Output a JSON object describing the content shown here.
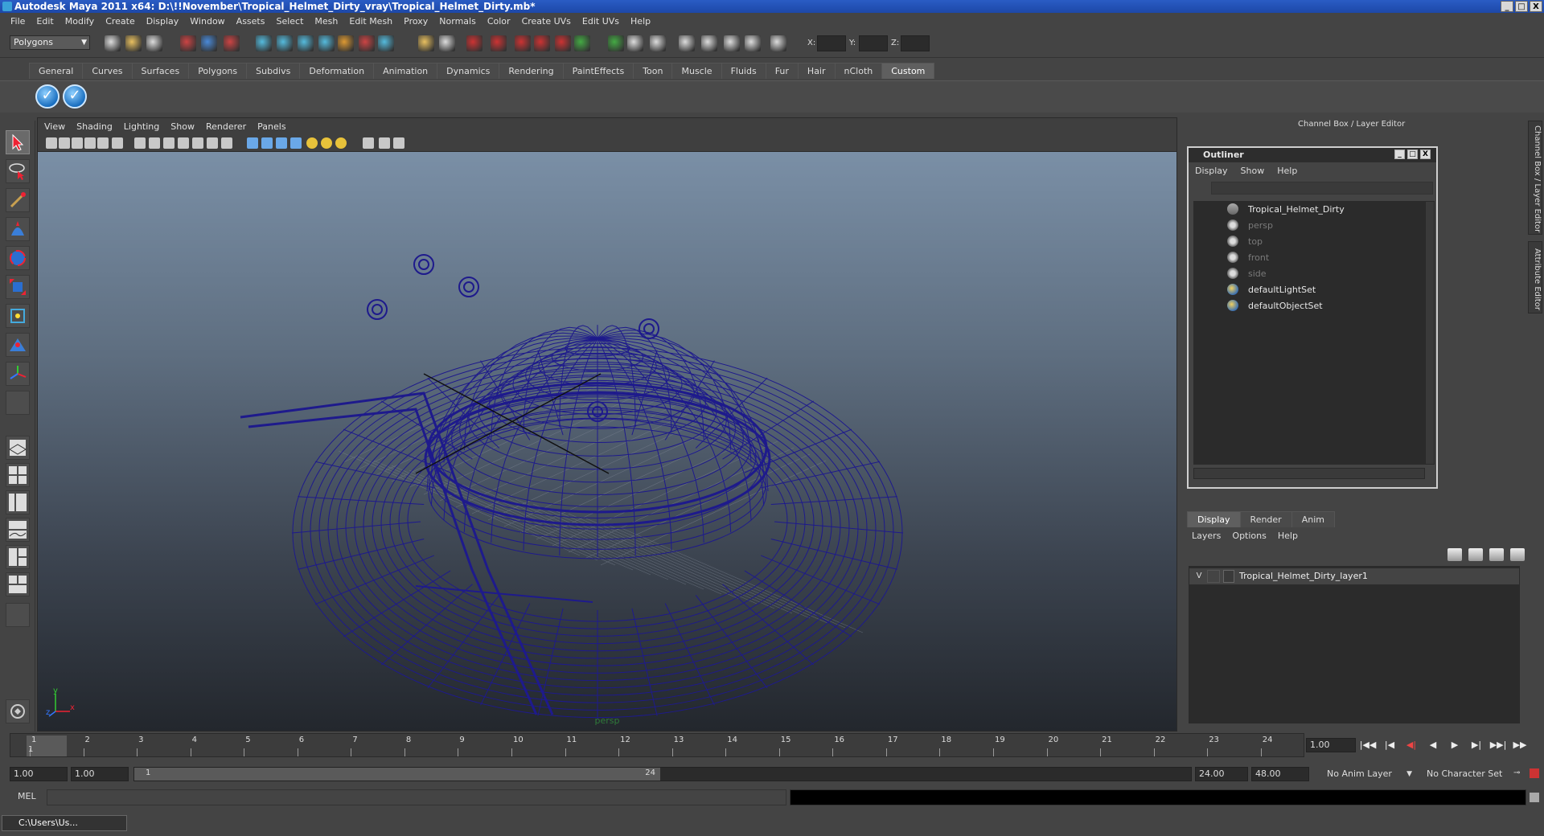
{
  "window": {
    "title": "Autodesk Maya 2011 x64: D:\\!!November\\Tropical_Helmet_Dirty_vray\\Tropical_Helmet_Dirty.mb*",
    "buttons": [
      "_",
      "□",
      "X"
    ]
  },
  "menubar": [
    "File",
    "Edit",
    "Modify",
    "Create",
    "Display",
    "Window",
    "Assets",
    "Select",
    "Mesh",
    "Edit Mesh",
    "Proxy",
    "Normals",
    "Color",
    "Create UVs",
    "Edit UVs",
    "Help"
  ],
  "statusline": {
    "mode": "Polygons",
    "x_label": "X:",
    "y_label": "Y:",
    "z_label": "Z:"
  },
  "shelf": {
    "tabs": [
      "General",
      "Curves",
      "Surfaces",
      "Polygons",
      "Subdivs",
      "Deformation",
      "Animation",
      "Dynamics",
      "Rendering",
      "PaintEffects",
      "Toon",
      "Muscle",
      "Fluids",
      "Fur",
      "Hair",
      "nCloth",
      "Custom"
    ],
    "active_tab": "Custom"
  },
  "viewport": {
    "menu": [
      "View",
      "Shading",
      "Lighting",
      "Show",
      "Renderer",
      "Panels"
    ],
    "camera_label": "persp",
    "axis_y": "y",
    "axis_x": "x",
    "axis_z": "z",
    "wire_color": "#1e1a8c"
  },
  "right_panel": {
    "header": "Channel Box / Layer Editor",
    "side_tabs": [
      "Channel Box / Layer Editor",
      "Attribute Editor"
    ]
  },
  "outliner": {
    "title": "Outliner",
    "menu": [
      "Display",
      "Show",
      "Help"
    ],
    "items": [
      {
        "label": "Tropical_Helmet_Dirty",
        "dim": false,
        "icon": "group-icon"
      },
      {
        "label": "persp",
        "dim": true,
        "icon": "camera-icon"
      },
      {
        "label": "top",
        "dim": true,
        "icon": "camera-icon"
      },
      {
        "label": "front",
        "dim": true,
        "icon": "camera-icon"
      },
      {
        "label": "side",
        "dim": true,
        "icon": "camera-icon"
      },
      {
        "label": "defaultLightSet",
        "dim": false,
        "icon": "set-icon"
      },
      {
        "label": "defaultObjectSet",
        "dim": false,
        "icon": "set-icon"
      }
    ]
  },
  "layer_editor": {
    "tabs": [
      "Display",
      "Render",
      "Anim"
    ],
    "active_tab": "Display",
    "menu": [
      "Layers",
      "Options",
      "Help"
    ],
    "layers": [
      {
        "visible": "V",
        "name": "Tropical_Helmet_Dirty_layer1"
      }
    ]
  },
  "timeline": {
    "ticks": [
      "1",
      "2",
      "3",
      "4",
      "5",
      "6",
      "7",
      "8",
      "9",
      "10",
      "11",
      "12",
      "13",
      "14",
      "15",
      "16",
      "17",
      "18",
      "19",
      "20",
      "21",
      "22",
      "23",
      "24"
    ],
    "current_frame": "1",
    "current_time_field": "1.00",
    "playback_buttons": [
      "|◀◀",
      "|◀",
      "◀|",
      "◀",
      "▶",
      "▶|",
      "▶▶|",
      "▶▶"
    ]
  },
  "range": {
    "start_field": "1.00",
    "playback_start": "1.00",
    "handle_start": "1",
    "handle_end": "24",
    "playback_end": "24.00",
    "end_field": "48.00",
    "anim_layer": "No Anim Layer",
    "character_set": "No Character Set"
  },
  "cmdline": {
    "label": "MEL"
  },
  "taskbar": {
    "task": "C:\\Users\\Us..."
  }
}
